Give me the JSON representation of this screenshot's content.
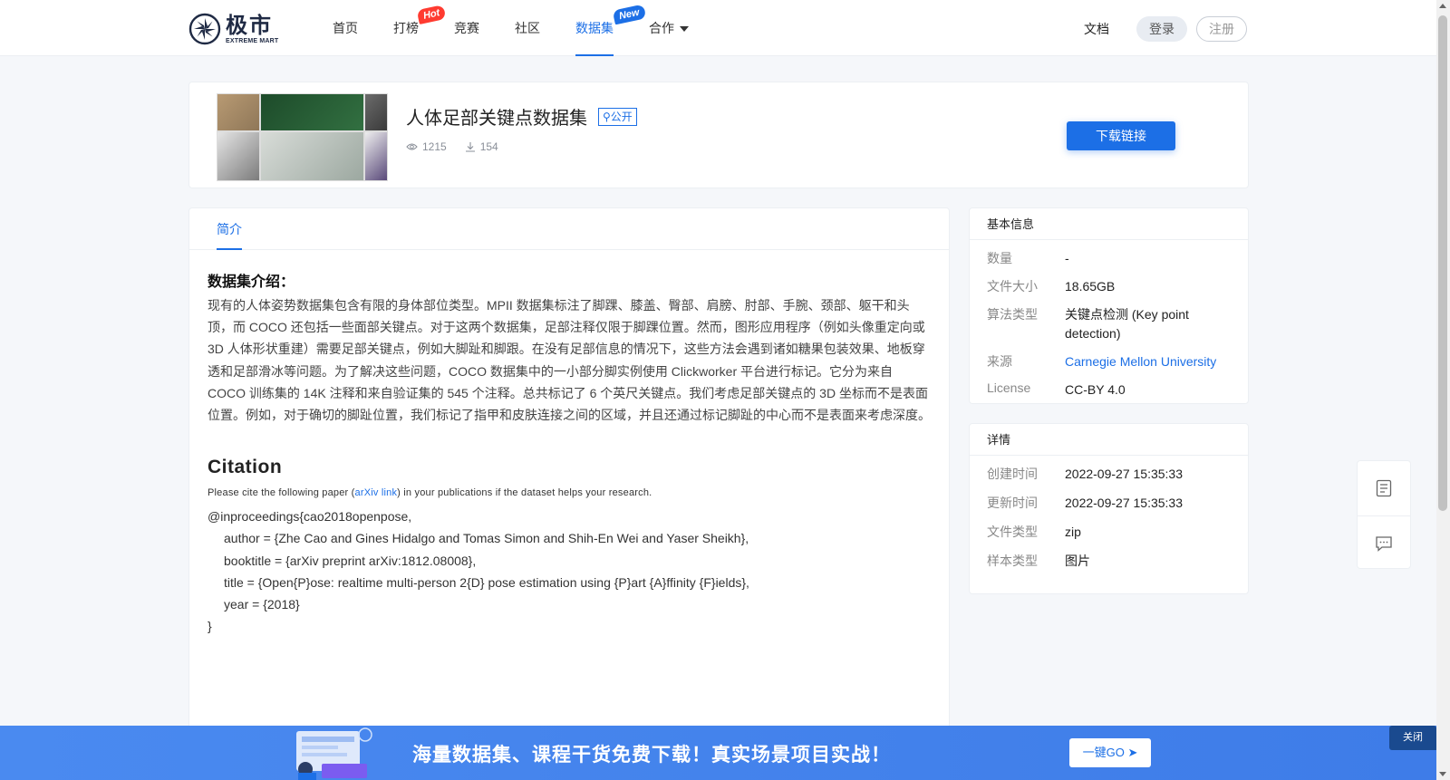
{
  "header": {
    "logo_cn": "极市",
    "logo_en": "EXTREME MART",
    "nav": [
      {
        "label": "首页"
      },
      {
        "label": "打榜",
        "badge": "Hot"
      },
      {
        "label": "竞赛"
      },
      {
        "label": "社区"
      },
      {
        "label": "数据集",
        "badge": "New",
        "active": true
      },
      {
        "label": "合作",
        "dropdown": true
      }
    ],
    "docs": "文档",
    "login": "登录",
    "register": "注册"
  },
  "dataset": {
    "title": "人体足部关键点数据集",
    "visibility": "公开",
    "views": "1215",
    "downloads": "154",
    "download_button": "下载链接"
  },
  "tabs": {
    "intro": "简介"
  },
  "intro": {
    "heading": "数据集介绍：",
    "text": "现有的人体姿势数据集包含有限的身体部位类型。MPII 数据集标注了脚踝、膝盖、臀部、肩膀、肘部、手腕、颈部、躯干和头顶，而 COCO 还包括一些面部关键点。对于这两个数据集，足部注释仅限于脚踝位置。然而，图形应用程序（例如头像重定向或 3D 人体形状重建）需要足部关键点，例如大脚趾和脚跟。在没有足部信息的情况下，这些方法会遇到诸如糖果包装效果、地板穿透和足部滑冰等问题。为了解决这些问题，COCO 数据集中的一小部分脚实例使用 Clickworker 平台进行标记。它分为来自 COCO 训练集的 14K 注释和来自验证集的 545 个注释。总共标记了 6 个英尺关键点。我们考虑足部关键点的 3D 坐标而不是表面位置。例如，对于确切的脚趾位置，我们标记了指甲和皮肤连接之间的区域，并且还通过标记脚趾的中心而不是表面来考虑深度。"
  },
  "citation": {
    "heading": "Citation",
    "prefix": "Please cite the following paper (",
    "link": "arXiv link",
    "suffix": ") in your publications if the dataset helps your research.",
    "bibtex": [
      "@inproceedings{cao2018openpose,",
      "author = {Zhe Cao and Gines Hidalgo and Tomas Simon and Shih-En Wei and Yaser Sheikh},",
      "booktitle = {arXiv preprint arXiv:1812.08008},",
      "title = {Open{P}ose: realtime multi-person 2{D} pose estimation using {P}art {A}ffinity {F}ields},",
      "year = {2018}",
      "}"
    ]
  },
  "basic_info": {
    "title": "基本信息",
    "rows": [
      {
        "key": "数量",
        "value": "-"
      },
      {
        "key": "文件大小",
        "value": "18.65GB"
      },
      {
        "key": "算法类型",
        "value": "关键点检测 (Key point detection)"
      },
      {
        "key": "来源",
        "value": "Carnegie Mellon University"
      },
      {
        "key": "License",
        "value": "CC-BY 4.0"
      }
    ]
  },
  "details": {
    "title": "详情",
    "rows": [
      {
        "key": "创建时间",
        "value": "2022-09-27 15:35:33"
      },
      {
        "key": "更新时间",
        "value": "2022-09-27 15:35:33"
      },
      {
        "key": "文件类型",
        "value": "zip"
      },
      {
        "key": "样本类型",
        "value": "图片"
      }
    ]
  },
  "side_tools": {
    "icons": [
      "document-icon",
      "comment-icon"
    ]
  },
  "banner": {
    "text": "海量数据集、课程干货免费下载！真实场景项目实战！",
    "go": "一键GO",
    "close": "关闭"
  },
  "colors": {
    "accent": "#1c6fe6",
    "banner": "#4a8af0",
    "hot_badge": "#ff3b30"
  }
}
